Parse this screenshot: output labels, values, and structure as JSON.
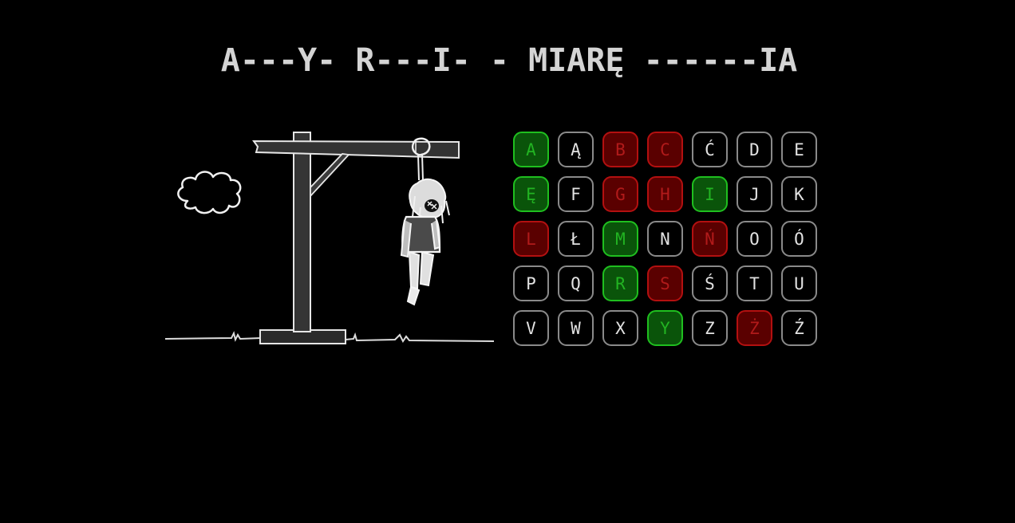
{
  "puzzle": {
    "text": "A---Y- R---I- - MIARĘ ------IA"
  },
  "keyboard": {
    "rows": [
      [
        {
          "letter": "A",
          "state": "correct"
        },
        {
          "letter": "Ą",
          "state": "unused"
        },
        {
          "letter": "B",
          "state": "wrong"
        },
        {
          "letter": "C",
          "state": "wrong"
        },
        {
          "letter": "Ć",
          "state": "unused"
        },
        {
          "letter": "D",
          "state": "unused"
        },
        {
          "letter": "E",
          "state": "unused"
        }
      ],
      [
        {
          "letter": "Ę",
          "state": "correct"
        },
        {
          "letter": "F",
          "state": "unused"
        },
        {
          "letter": "G",
          "state": "wrong"
        },
        {
          "letter": "H",
          "state": "wrong"
        },
        {
          "letter": "I",
          "state": "correct"
        },
        {
          "letter": "J",
          "state": "unused"
        },
        {
          "letter": "K",
          "state": "unused"
        }
      ],
      [
        {
          "letter": "L",
          "state": "wrong"
        },
        {
          "letter": "Ł",
          "state": "unused"
        },
        {
          "letter": "M",
          "state": "correct"
        },
        {
          "letter": "N",
          "state": "unused"
        },
        {
          "letter": "Ń",
          "state": "wrong"
        },
        {
          "letter": "O",
          "state": "unused"
        },
        {
          "letter": "Ó",
          "state": "unused"
        }
      ],
      [
        {
          "letter": "P",
          "state": "unused"
        },
        {
          "letter": "Q",
          "state": "unused"
        },
        {
          "letter": "R",
          "state": "correct"
        },
        {
          "letter": "S",
          "state": "wrong"
        },
        {
          "letter": "Ś",
          "state": "unused"
        },
        {
          "letter": "T",
          "state": "unused"
        },
        {
          "letter": "U",
          "state": "unused"
        }
      ],
      [
        {
          "letter": "V",
          "state": "unused"
        },
        {
          "letter": "W",
          "state": "unused"
        },
        {
          "letter": "X",
          "state": "unused"
        },
        {
          "letter": "Y",
          "state": "correct"
        },
        {
          "letter": "Z",
          "state": "unused"
        },
        {
          "letter": "Ż",
          "state": "wrong"
        },
        {
          "letter": "Ź",
          "state": "unused"
        }
      ]
    ]
  },
  "colors": {
    "background": "#000000",
    "text": "#d4d4d4",
    "correct": "#1fbf1f",
    "wrong": "#b31010",
    "unused_border": "#8a8a8a"
  },
  "icons": {
    "gallows": "gallows-icon",
    "cloud": "cloud-icon",
    "hanged_man": "hanged-figure-icon"
  }
}
